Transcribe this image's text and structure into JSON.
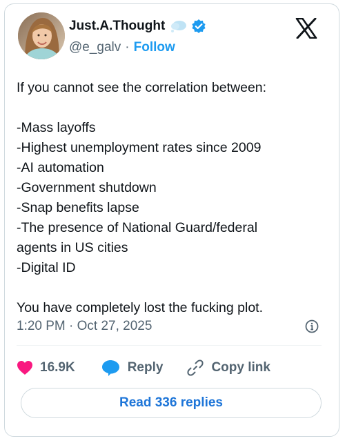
{
  "author": {
    "display_name": "Just.A.Thought",
    "handle": "@e_galv",
    "separator": "·",
    "follow_label": "Follow",
    "name_emoji_icon": "thought-bubble-icon",
    "verified_icon": "verified-badge-icon"
  },
  "platform": {
    "logo_icon": "x-logo-icon"
  },
  "tweet": {
    "lines": [
      "If you cannot see the correlation between:",
      "-Mass layoffs",
      "-Highest unemployment rates since 2009",
      "-AI automation",
      "-Government shutdown",
      "-Snap benefits lapse",
      "-The presence of National Guard/federal",
      "agents in US cities",
      "-Digital ID",
      "You have completely lost the fucking plot."
    ],
    "timestamp": "1:20 PM · Oct 27, 2025"
  },
  "actions": {
    "likes_count": "16.9K",
    "reply_label": "Reply",
    "copy_link_label": "Copy link"
  },
  "read_replies_label": "Read 336 replies",
  "colors": {
    "accent_blue": "#1d9bf0",
    "heart_pink": "#f91880",
    "text_primary": "#0f1419",
    "text_secondary": "#536471",
    "border": "#cfd9de"
  }
}
